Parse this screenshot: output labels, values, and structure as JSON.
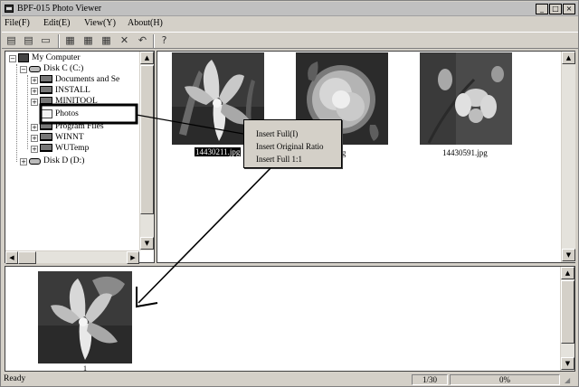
{
  "window": {
    "title": "BPF-015 Photo Viewer",
    "controls": [
      "_",
      "□",
      "×"
    ]
  },
  "menu": [
    "File(F)",
    "Edit(E)",
    "View(Y)",
    "About(H)"
  ],
  "toolbar": {
    "icons": [
      "film-strip-icon",
      "film-strip-2-icon",
      "film-strip-3-icon",
      "print-icon",
      "print-2-icon",
      "print-3-icon",
      "delete-icon",
      "undo-icon",
      "help-icon"
    ],
    "glyphs": [
      "▤",
      "▤",
      "▭",
      "▦",
      "▦",
      "▦",
      "✕",
      "↶",
      "?"
    ]
  },
  "tree": {
    "items": [
      {
        "label": "My Computer",
        "expander": "−",
        "icon": "computer-icon"
      },
      {
        "label": "Disk C (C:)",
        "expander": "−",
        "icon": "disk-icon"
      },
      {
        "label": "Documents and Se",
        "expander": "+",
        "icon": "network-folder-icon"
      },
      {
        "label": "INSTALL",
        "expander": "+",
        "icon": "network-folder-icon"
      },
      {
        "label": "MINITOOL",
        "expander": "+",
        "icon": "network-folder-icon"
      },
      {
        "label": "Photos",
        "expander": "",
        "icon": "folder-icon"
      },
      {
        "label": "Program Files",
        "expander": "+",
        "icon": "network-folder-icon"
      },
      {
        "label": "WINNT",
        "expander": "+",
        "icon": "network-folder-icon"
      },
      {
        "label": "WUTemp",
        "expander": "+",
        "icon": "network-folder-icon"
      },
      {
        "label": "Disk D (D:)",
        "expander": "+",
        "icon": "disk-icon"
      }
    ]
  },
  "thumbnails": [
    {
      "caption": "14430211.jpg",
      "selected": true
    },
    {
      "caption": "11.jpg",
      "selected": false
    },
    {
      "caption": "14430591.jpg",
      "selected": false
    }
  ],
  "context_menu": {
    "items": [
      "Insert Full(I)",
      "Insert Original Ratio",
      "Insert Full 1:1"
    ]
  },
  "preview": {
    "index_label": "1"
  },
  "status": {
    "text": "Ready",
    "page": "1/30",
    "progress": "0%"
  },
  "colors": {
    "chrome": "#d4d0c8",
    "highlight_box": "#000000"
  }
}
